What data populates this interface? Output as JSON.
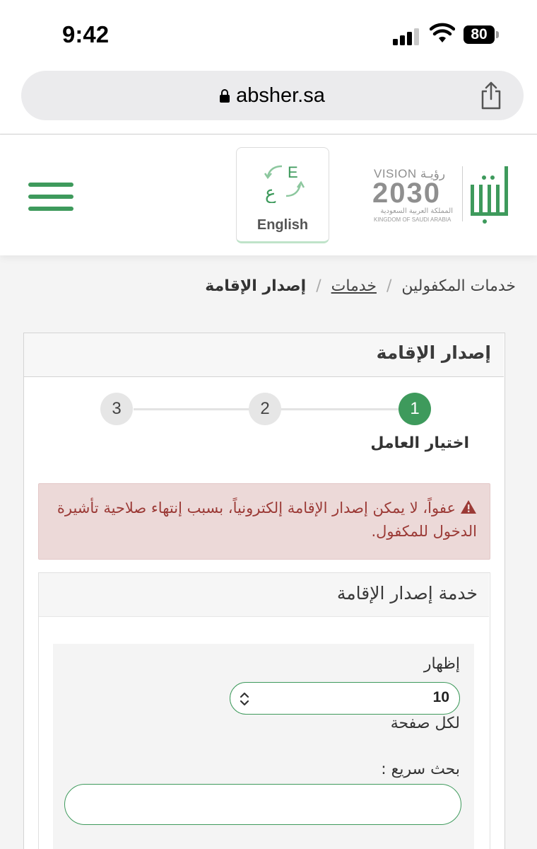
{
  "status_bar": {
    "time": "9:42",
    "battery": "80"
  },
  "browser": {
    "url": "absher.sa"
  },
  "header": {
    "language_button": {
      "label": "English"
    },
    "vision_logo": {
      "line1": "VISION رؤيـة",
      "year": "2030",
      "arabic": "المملكة العربية السعودية",
      "english": "KINGDOM OF SAUDI ARABIA"
    }
  },
  "breadcrumb": {
    "items": [
      "خدمات المكفولين",
      "خدمات",
      "إصدار الإقامة"
    ],
    "separator": "/"
  },
  "card": {
    "title": "إصدار الإقامة",
    "steps": [
      {
        "number": "1",
        "label": "اختيار العامل",
        "active": true
      },
      {
        "number": "2"
      },
      {
        "number": "3"
      }
    ],
    "alert": {
      "text": "عفواً، لا يمكن إصدار الإقامة إلكترونياً، بسبب إنتهاء صلاحية تأشيرة الدخول للمكفول."
    },
    "panel": {
      "title": "خدمة إصدار الإقامة",
      "show_label": "إظهار",
      "page_size": "10",
      "per_page_label": "لكل صفحة",
      "search_label": "بحث سريع :",
      "search_value": ""
    }
  },
  "colors": {
    "brand_green": "#3e9a5c",
    "alert_bg": "#ecd9d8",
    "alert_text": "#9b3a36"
  },
  "icons": [
    "lock-icon",
    "share-icon",
    "hamburger-menu-icon",
    "language-switch-icon",
    "warning-icon",
    "select-arrows-icon"
  ]
}
